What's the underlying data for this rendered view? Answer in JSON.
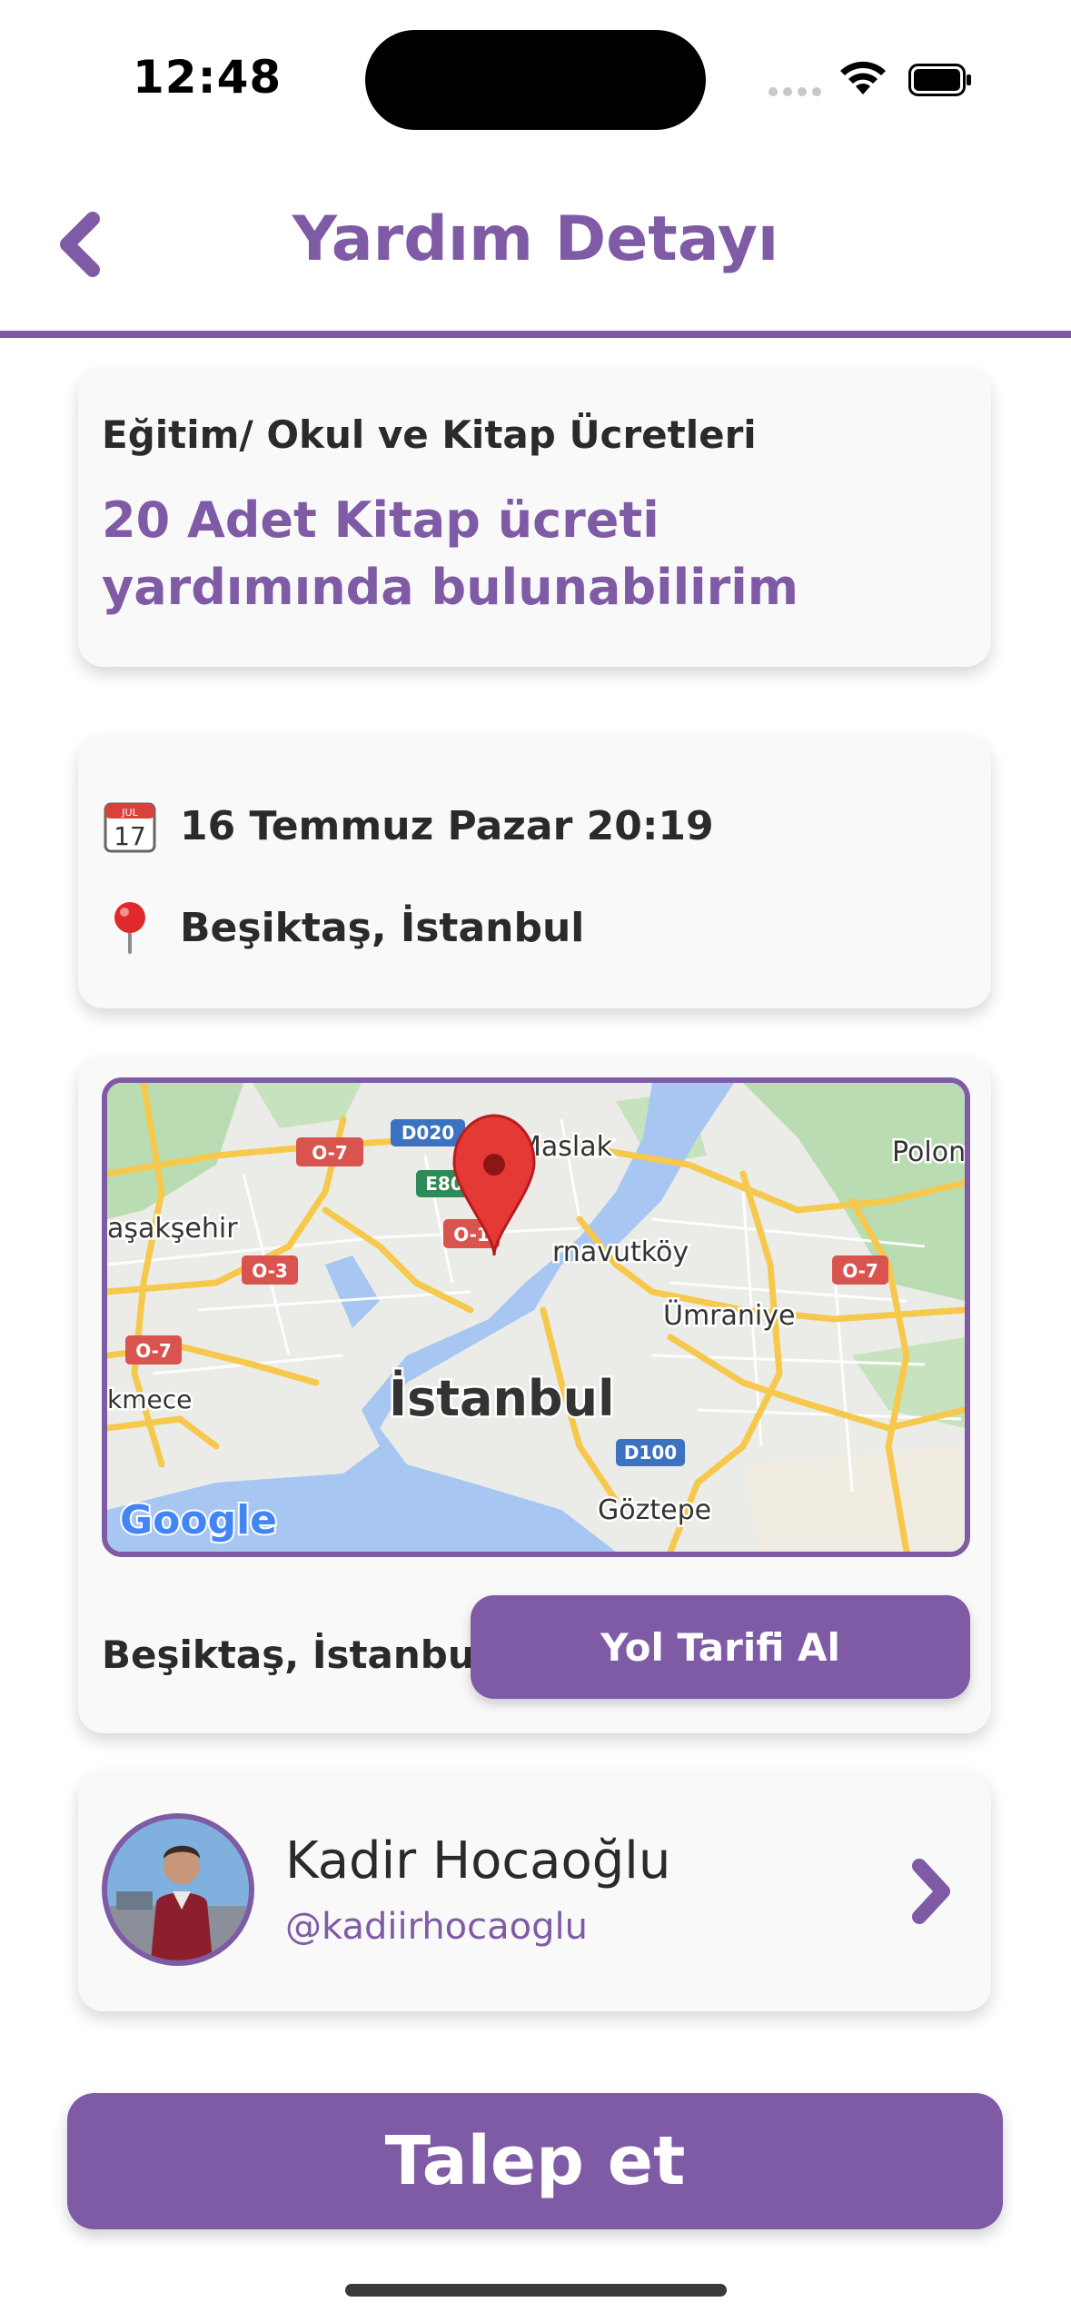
{
  "status_bar": {
    "time": "12:48"
  },
  "header": {
    "title": "Yardım Detayı"
  },
  "request": {
    "category": "Eğitim/ Okul ve Kitap Ücretleri",
    "title": "20 Adet Kitap ücreti yardımında bulunabilirim"
  },
  "info": {
    "date": "16 Temmuz Pazar 20:19",
    "location": "Beşiktaş, İstanbul",
    "calendar_icon": {
      "month": "JUL",
      "day": "17"
    }
  },
  "map": {
    "labels": {
      "maslak": "Maslak",
      "polon": "Polon",
      "basaksehir": "aşakşehir",
      "arnavutkoy": "rnavutköy",
      "umraniye": "Ümraniye",
      "kmece": "kmece",
      "istanbul": "İstanbul",
      "goztepe": "Göztepe",
      "google": "Google"
    },
    "road_shields": {
      "d020": "D020",
      "e80": "E80",
      "o7a": "O-7",
      "o1": "O-1",
      "o3": "O-3",
      "o7b": "O-7",
      "o7c": "O-7",
      "d100": "D100"
    },
    "location_label": "Beşiktaş, İstanbul",
    "route_button": "Yol Tarifi Al"
  },
  "user": {
    "name": "Kadir Hocaoğlu",
    "handle": "@kadiirhocaoglu"
  },
  "primary_action": {
    "label": "Talep et"
  },
  "colors": {
    "accent": "#7f5ba6",
    "card_bg": "#f9f9f9",
    "text": "#2a2a2a"
  }
}
